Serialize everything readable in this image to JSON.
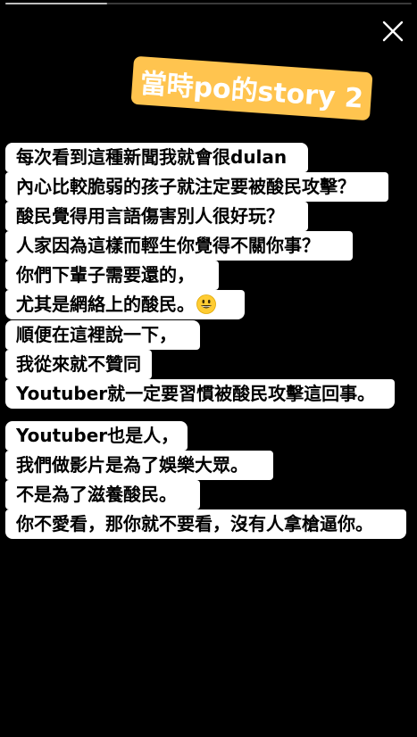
{
  "story": {
    "progress": 0.25,
    "colors": {
      "background": "#000000",
      "sticker_bg": "#ffc44f",
      "sticker_text": "#ffffff",
      "text_bg": "#ffffff",
      "text": "#000000"
    }
  },
  "controls": {
    "close_icon": "close-icon"
  },
  "sticker": {
    "text": "當時po的story 2"
  },
  "blocks": [
    {
      "lines": [
        "每次看到這種新聞我就會很dulan",
        "內心比較脆弱的孩子就注定要被酸民攻擊？",
        "酸民覺得用言語傷害別人很好玩？",
        "人家因為這樣而輕生你覺得不關你事？",
        "你們下輩子需要還的，",
        "尤其是網絡上的酸民。"
      ],
      "emoji": "grinning-face-emoji"
    },
    {
      "lines": [
        "順便在這裡說一下，",
        "我從來就不贊同",
        "Youtuber就一定要習慣被酸民攻擊這回事。"
      ]
    },
    {
      "lines": [
        "Youtuber也是人，",
        "我們做影片是為了娛樂大眾。",
        "不是為了滋養酸民。",
        "你不愛看，那你就不要看，沒有人拿槍逼你。"
      ]
    }
  ]
}
